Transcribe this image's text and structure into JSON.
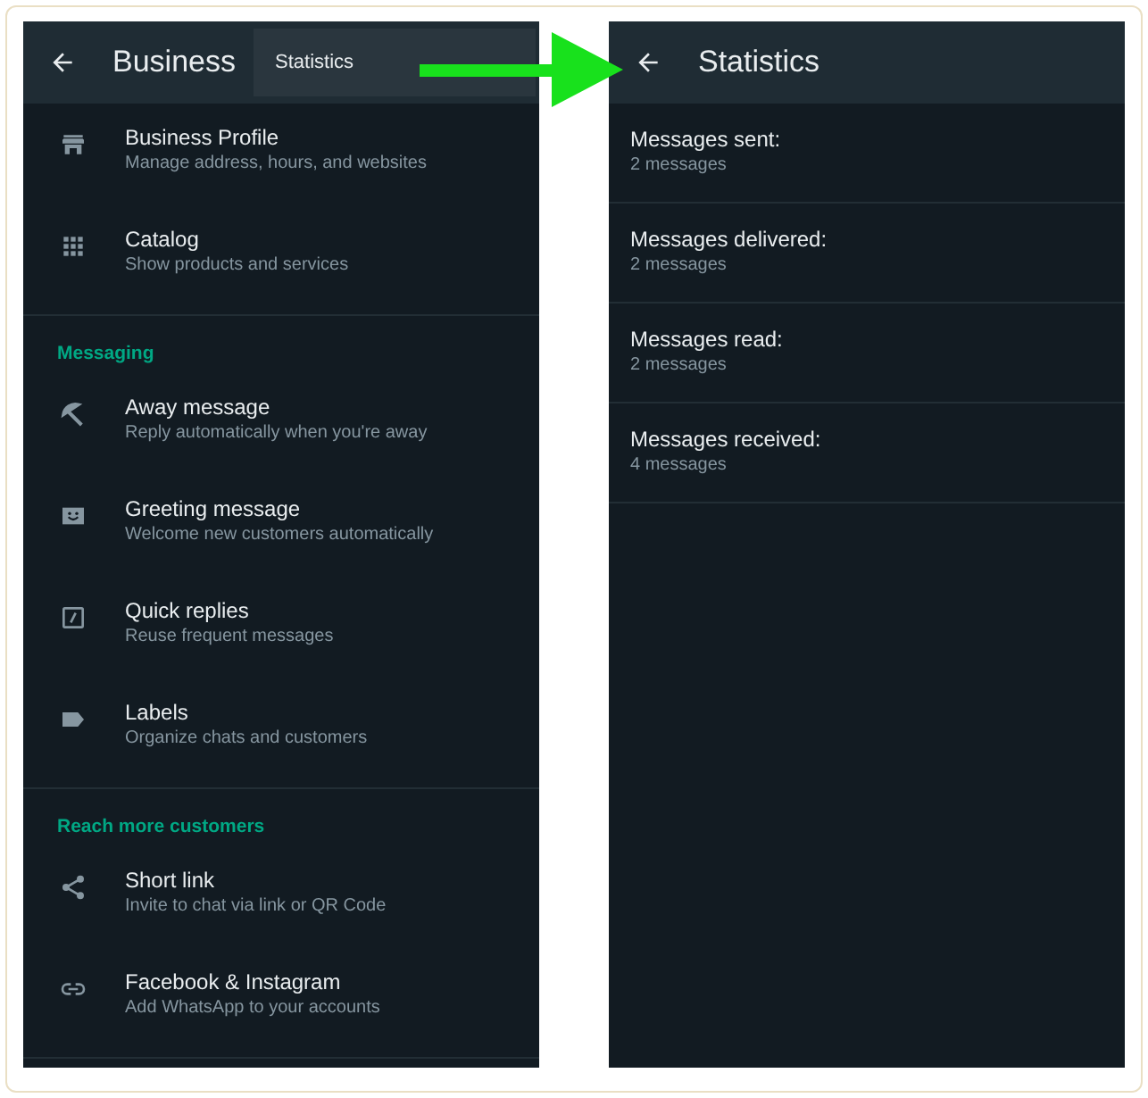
{
  "left_screen": {
    "header": {
      "title": "Business"
    },
    "overflow_menu": {
      "items": [
        "Statistics"
      ]
    },
    "sections": [
      {
        "items": [
          {
            "title": "Business Profile",
            "subtitle": "Manage address, hours, and websites"
          },
          {
            "title": "Catalog",
            "subtitle": "Show products and services"
          }
        ]
      },
      {
        "heading": "Messaging",
        "items": [
          {
            "title": "Away message",
            "subtitle": "Reply automatically when you're away"
          },
          {
            "title": "Greeting message",
            "subtitle": "Welcome new customers automatically"
          },
          {
            "title": "Quick replies",
            "subtitle": "Reuse frequent messages"
          },
          {
            "title": "Labels",
            "subtitle": "Organize chats and customers"
          }
        ]
      },
      {
        "heading": "Reach more customers",
        "items": [
          {
            "title": "Short link",
            "subtitle": "Invite to chat via link or QR Code"
          },
          {
            "title": "Facebook & Instagram",
            "subtitle": "Add WhatsApp to your accounts"
          }
        ]
      }
    ]
  },
  "right_screen": {
    "header": {
      "title": "Statistics"
    },
    "stats": [
      {
        "label": "Messages sent:",
        "value": "2 messages"
      },
      {
        "label": "Messages delivered:",
        "value": "2 messages"
      },
      {
        "label": "Messages read:",
        "value": "2 messages"
      },
      {
        "label": "Messages received:",
        "value": "4 messages"
      }
    ]
  }
}
